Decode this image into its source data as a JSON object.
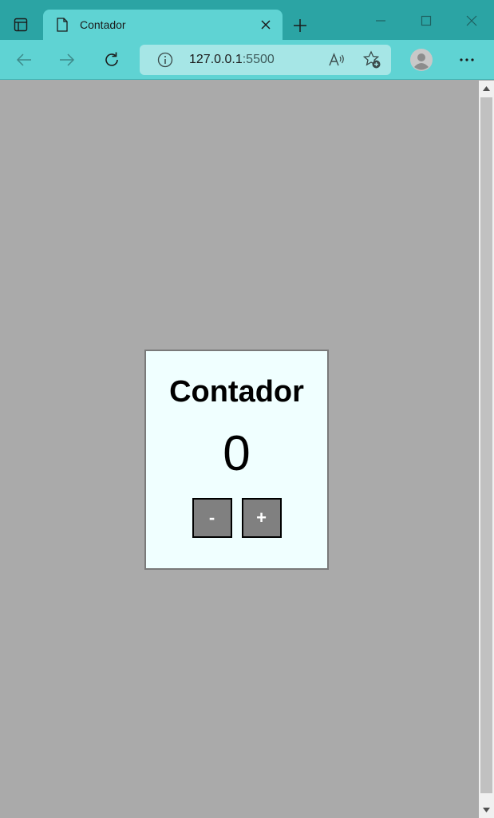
{
  "browser": {
    "tab_title": "Contador",
    "address_host": "127.0.0.1",
    "address_port": ":5500"
  },
  "page": {
    "title": "Contador",
    "counter_value": "0",
    "decrement_label": "-",
    "increment_label": "+"
  },
  "icons": {
    "tab_actions": "tab-actions-icon",
    "favicon": "page-icon",
    "close": "close-icon",
    "new_tab": "plus-icon",
    "minimize": "minimize-icon",
    "maximize": "maximize-icon",
    "window_close": "window-close-icon",
    "back": "back-arrow-icon",
    "forward": "forward-arrow-icon",
    "refresh": "refresh-icon",
    "site_info": "info-icon",
    "read_aloud": "read-aloud-icon",
    "favorites": "favorite-add-icon",
    "profile": "profile-icon",
    "menu": "more-icon"
  },
  "colors": {
    "tab_strip": "#2ba4a4",
    "toolbar": "#5fd3d3",
    "address_bar": "#a6e6e6",
    "page_background": "#aaaaaa",
    "card_background": "#f0ffff",
    "button_background": "#808080"
  }
}
